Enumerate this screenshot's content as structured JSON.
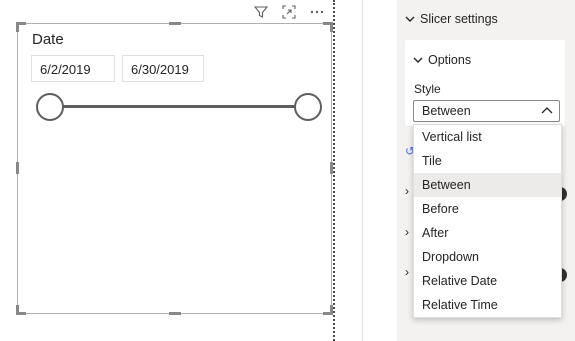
{
  "visual": {
    "title": "Date",
    "start_date": "6/2/2019",
    "end_date": "6/30/2019",
    "range_start_fraction": 0,
    "range_end_fraction": 1
  },
  "visual_header": {
    "icons": [
      "filter-icon",
      "focus-mode-icon",
      "more-options-icon"
    ]
  },
  "format_pane": {
    "section_title": "Slicer settings",
    "options_card": {
      "title": "Options",
      "style_label": "Style",
      "style_selected": "Between"
    }
  },
  "dropdown": {
    "options": [
      "Vertical list",
      "Tile",
      "Between",
      "Before",
      "After",
      "Dropdown",
      "Relative Date",
      "Relative Time"
    ],
    "selected_index": 2
  },
  "colors": {
    "slider": "#605e5c",
    "pane_background": "#f3f2f1",
    "selected_option": "#edebe9"
  }
}
